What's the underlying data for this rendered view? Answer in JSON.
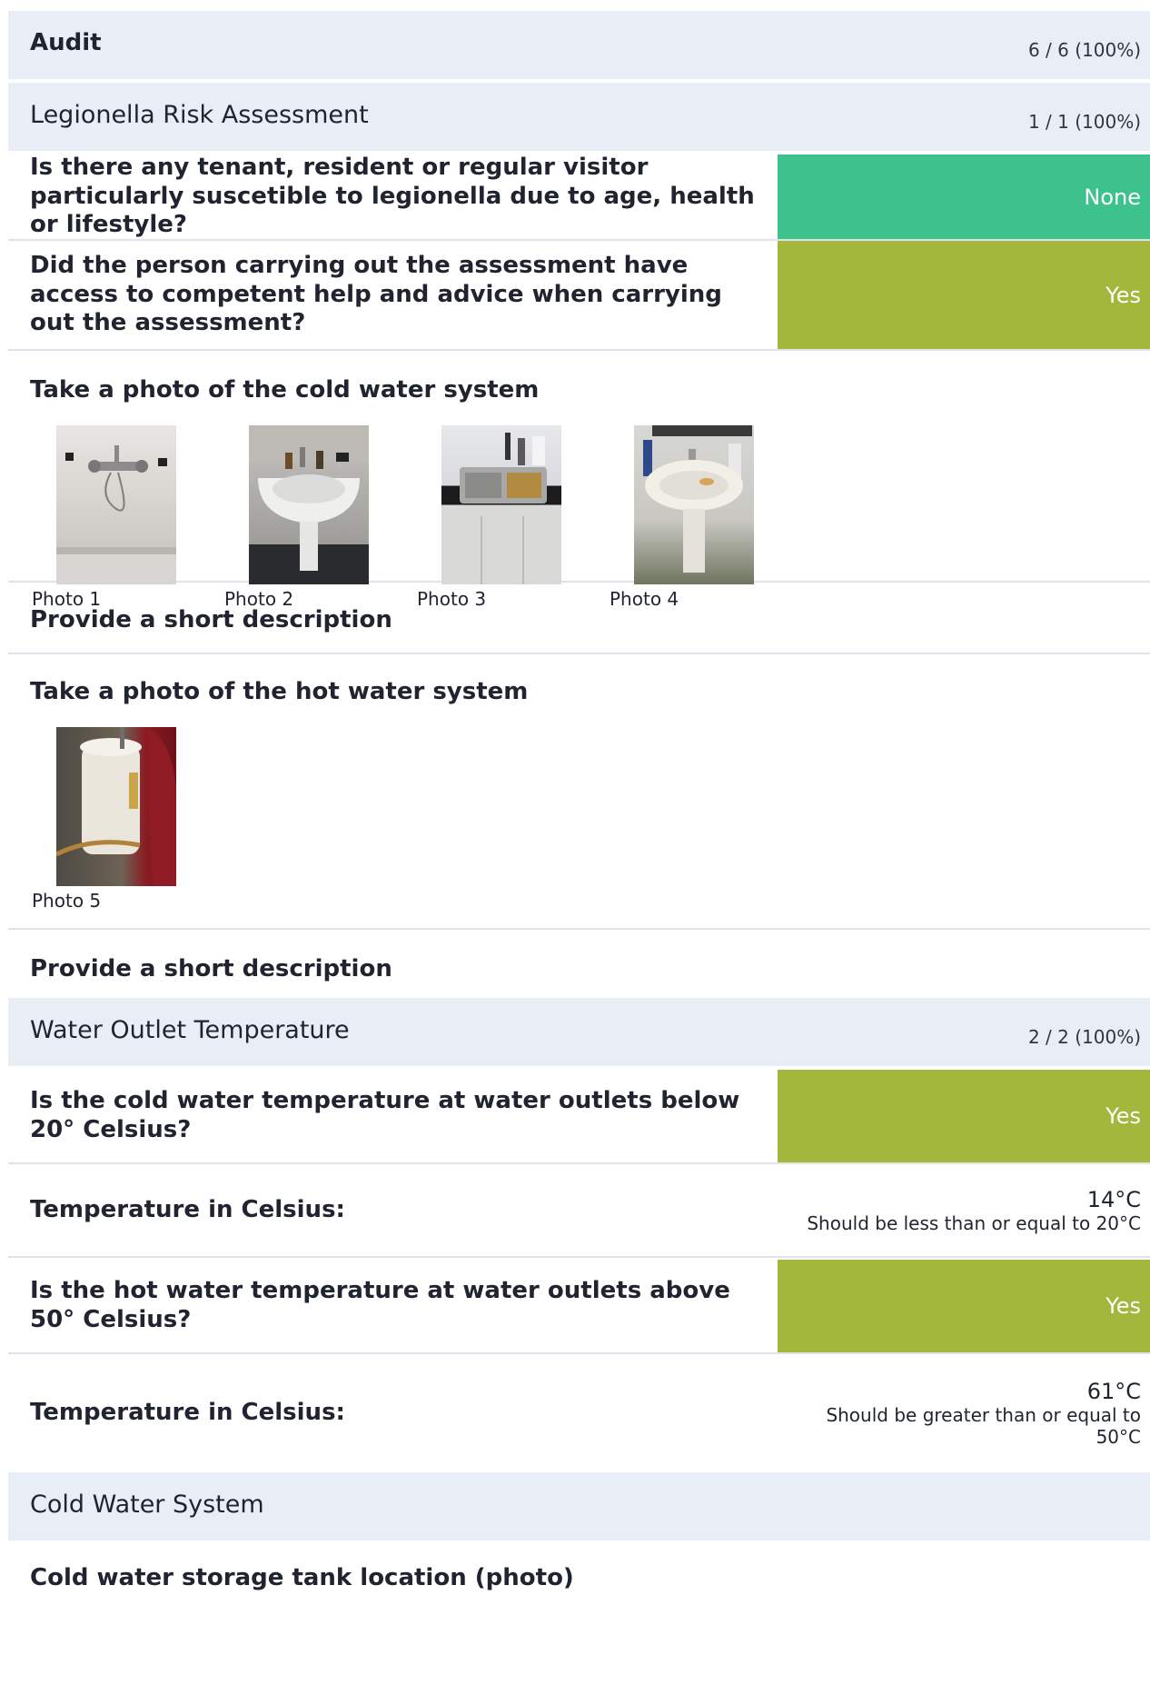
{
  "audit": {
    "title": "Audit",
    "score": "6 / 6 (100%)"
  },
  "sections": {
    "legionella": {
      "title": "Legionella Risk Assessment",
      "score": "1 / 1 (100%)",
      "q1": {
        "text": "Is there any tenant, resident or regular visitor particularly suscetible to legionella due to age, health or lifestyle?",
        "answer": "None"
      },
      "q2": {
        "text": "Did the person carrying out the assessment have access to competent help and advice when carrying out the assessment?",
        "answer": "Yes"
      },
      "cold_photo": {
        "text": "Take a photo of the cold water system",
        "photos": [
          "Photo 1",
          "Photo 2",
          "Photo 3",
          "Photo 4"
        ]
      },
      "desc1": "Provide a short description",
      "hot_photo": {
        "text": "Take a photo of the hot water system",
        "photos": [
          "Photo 5"
        ]
      },
      "desc2": "Provide a short description"
    },
    "water_outlet": {
      "title": "Water Outlet Temperature",
      "score": "2 / 2 (100%)",
      "q_cold": {
        "text": "Is the cold water temperature at water outlets below 20° Celsius?",
        "answer": "Yes"
      },
      "t_cold": {
        "label": "Temperature in Celsius:",
        "value": "14°C",
        "note": "Should be less than or equal to 20°C"
      },
      "q_hot": {
        "text": "Is the hot water temperature at water outlets above 50° Celsius?",
        "answer": "Yes"
      },
      "t_hot": {
        "label": "Temperature in Celsius:",
        "value": "61°C",
        "note": "Should be greater than or equal to 50°C"
      }
    },
    "cold_water_system": {
      "title": "Cold Water System",
      "q_tank": "Cold water storage tank location (photo)"
    }
  },
  "colors": {
    "answer_none": "#3ec28d",
    "answer_yes": "#a2b73c",
    "band": "#e9edf5"
  }
}
